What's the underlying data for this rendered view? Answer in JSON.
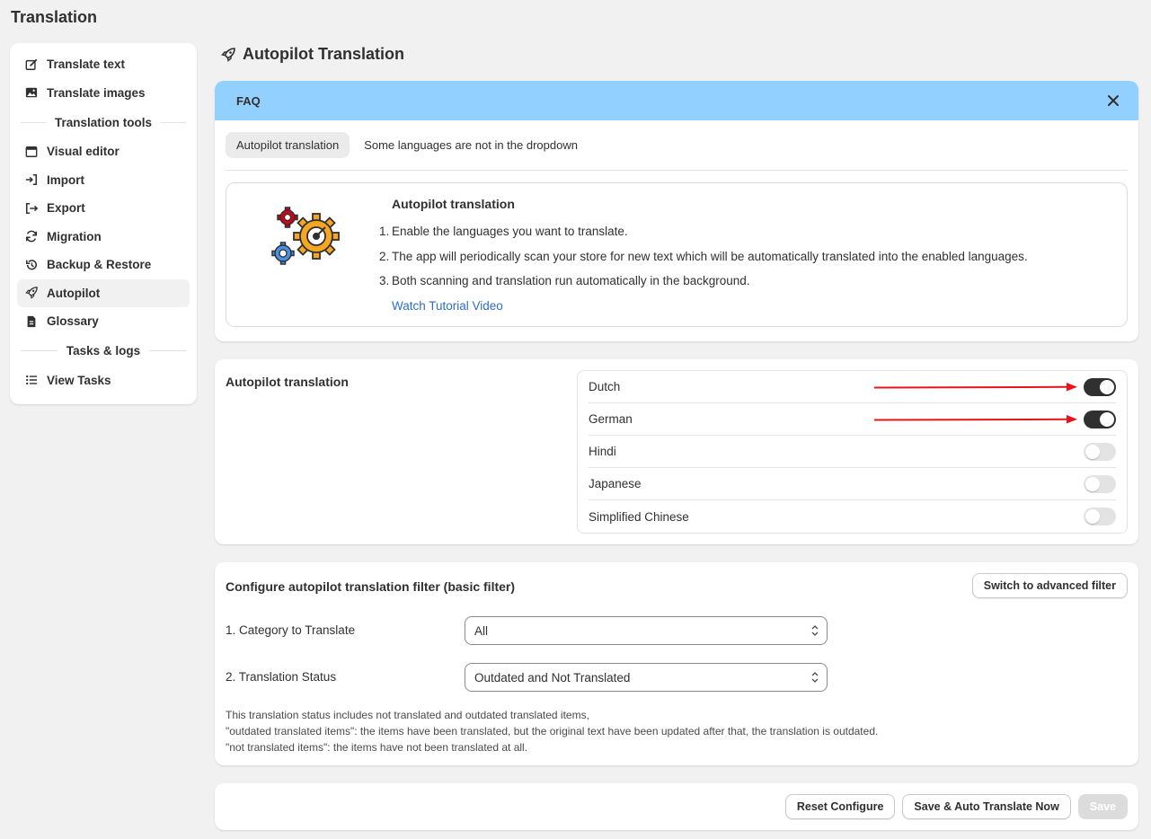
{
  "app": {
    "title": "Translation"
  },
  "sidebar": {
    "items_top": [
      {
        "label": "Translate text",
        "icon": "edit-icon"
      },
      {
        "label": "Translate images",
        "icon": "image-icon"
      }
    ],
    "section_tools": "Translation tools",
    "items_tools": [
      {
        "label": "Visual editor",
        "icon": "window-icon"
      },
      {
        "label": "Import",
        "icon": "import-icon"
      },
      {
        "label": "Export",
        "icon": "export-icon"
      },
      {
        "label": "Migration",
        "icon": "refresh-icon"
      },
      {
        "label": "Backup & Restore",
        "icon": "history-icon"
      },
      {
        "label": "Autopilot",
        "icon": "rocket-icon",
        "active": true
      },
      {
        "label": "Glossary",
        "icon": "document-icon"
      }
    ],
    "section_tasks": "Tasks & logs",
    "items_tasks": [
      {
        "label": "View Tasks",
        "icon": "list-icon"
      }
    ]
  },
  "page": {
    "heading": "Autopilot Translation"
  },
  "faq": {
    "header": "FAQ",
    "tabs": [
      "Autopilot translation",
      "Some languages are not in the dropdown"
    ],
    "box_title": "Autopilot translation",
    "steps": [
      {
        "num": "1.",
        "text": "Enable the languages you want to translate."
      },
      {
        "num": "2.",
        "text": "The app will periodically scan your store for new text which will be automatically translated into the enabled languages."
      },
      {
        "num": "3.",
        "text": "Both scanning and translation run automatically in the background."
      }
    ],
    "link": "Watch Tutorial Video"
  },
  "languages": {
    "title": "Autopilot translation",
    "items": [
      {
        "name": "Dutch",
        "enabled": true
      },
      {
        "name": "German",
        "enabled": true
      },
      {
        "name": "Hindi",
        "enabled": false
      },
      {
        "name": "Japanese",
        "enabled": false
      },
      {
        "name": "Simplified Chinese",
        "enabled": false
      }
    ],
    "arrow_color": "#e8141c"
  },
  "filter": {
    "title": "Configure autopilot translation filter (basic filter)",
    "switch_button": "Switch to advanced filter",
    "category_label": "1. Category to Translate",
    "category_value": "All",
    "status_label": "2. Translation Status",
    "status_value": "Outdated and Not Translated",
    "notes": [
      "This translation status includes not translated and outdated translated items,",
      "\"outdated translated items\": the items have been translated, but the original text have been updated after that, the translation is outdated.",
      "\"not translated items\": the items have not been translated at all."
    ]
  },
  "footer": {
    "reset": "Reset Configure",
    "save_auto": "Save & Auto Translate Now",
    "save": "Save"
  },
  "colors": {
    "faq_header": "#91d0ff",
    "toggle_on": "#303030",
    "link": "#2c6ecb"
  }
}
